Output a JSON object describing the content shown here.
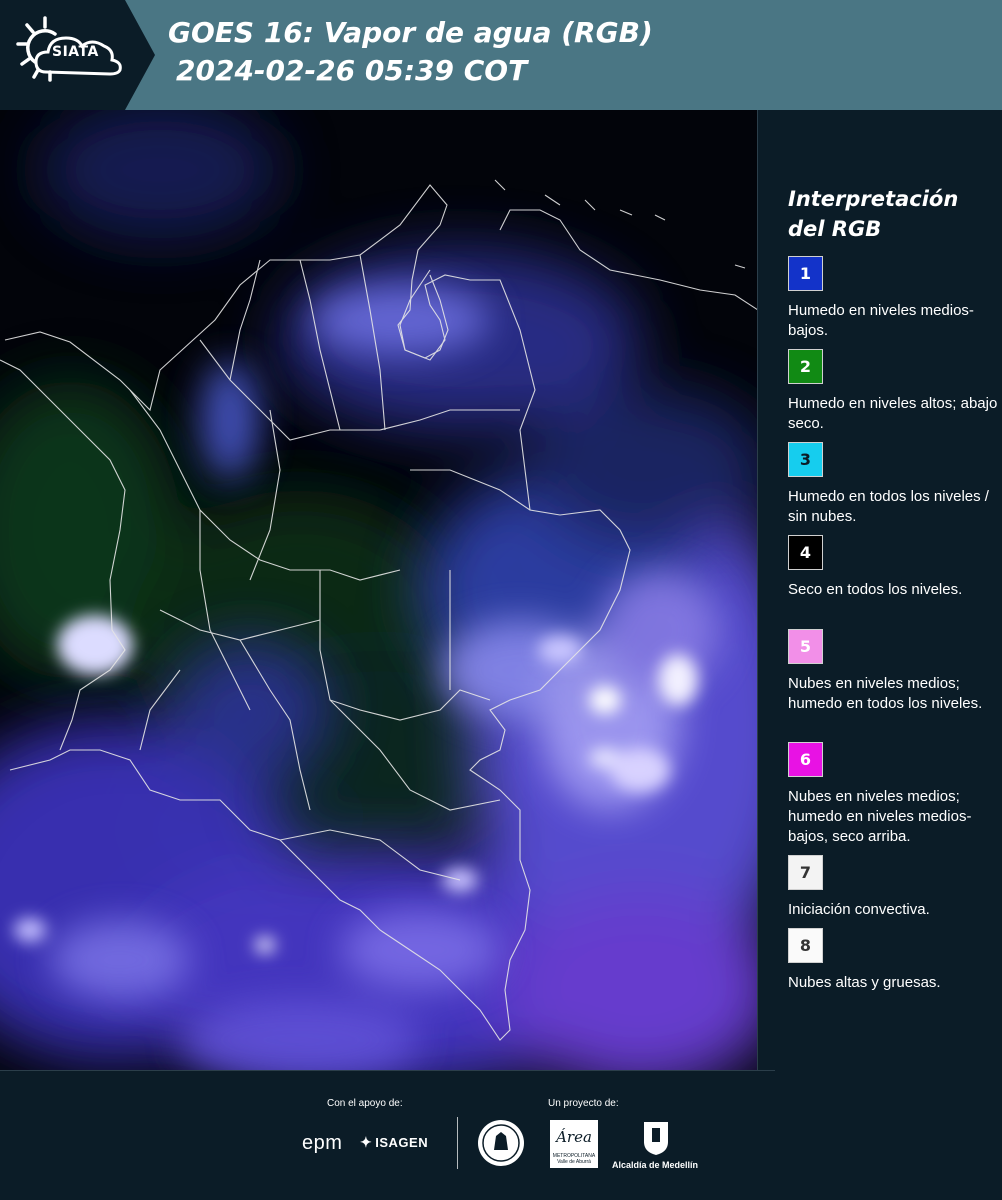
{
  "header": {
    "logo_text": "SIATA",
    "title_line1": "GOES 16: Vapor de agua (RGB)",
    "title_line2": "2024-02-26 05:39 COT",
    "background_color": "#4a7684"
  },
  "legend": {
    "title": "Interpretación del RGB",
    "items": [
      {
        "number": "1",
        "color": "#1333c9",
        "text_color": "#ffffff",
        "text": "Humedo en niveles medios-bajos."
      },
      {
        "number": "2",
        "color": "#118a14",
        "text_color": "#ffffff",
        "text": "Humedo en niveles altos; abajo seco."
      },
      {
        "number": "3",
        "color": "#16cdee",
        "text_color": "#0b1c27",
        "text": "Humedo en todos los niveles / sin nubes."
      },
      {
        "number": "4",
        "color": "#000000",
        "text_color": "#ffffff",
        "text": "Seco en todos los niveles."
      },
      {
        "number": "5",
        "color": "#f28fe8",
        "text_color": "#ffffff",
        "text": "Nubes en niveles medios; humedo en todos los niveles."
      },
      {
        "number": "6",
        "color": "#e812e4",
        "text_color": "#ffffff",
        "text": "Nubes en niveles medios; humedo en niveles medios-bajos, seco arriba."
      },
      {
        "number": "7",
        "color": "#f3f3f3",
        "text_color": "#333333",
        "text": "Iniciación convectiva."
      },
      {
        "number": "8",
        "color": "#fafafa",
        "text_color": "#333333",
        "text": "Nubes altas y gruesas."
      }
    ]
  },
  "footer": {
    "support_label": "Con el apoyo de:",
    "project_label": "Un proyecto de:",
    "sponsor_1": "epm",
    "sponsor_2": "ISAGEN",
    "partner_1": "Área",
    "partner_1_sub": "METROPOLITANA Valle de Aburrá",
    "partner_2": "Alcaldía de Medellín"
  },
  "map": {
    "description_icon": "satellite-map",
    "colors": {
      "background": "#02040a",
      "moist_blue": "#4a3fd0",
      "dry_green": "#10301a",
      "cloud_white": "#e8e6ff",
      "border_line": "#e6e6e6"
    }
  }
}
